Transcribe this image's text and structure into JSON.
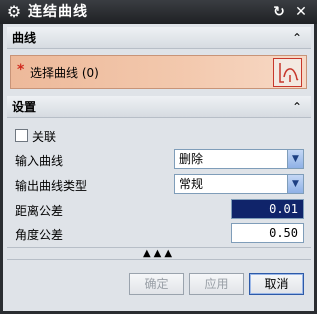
{
  "window": {
    "title": "连结曲线",
    "gear_icon": "gear-icon",
    "reset_icon": "reset-icon",
    "close_icon": "close-icon"
  },
  "sections": {
    "curve": {
      "header": "曲线",
      "select_label": "选择曲线 (0)",
      "required_marker": "*",
      "curve_button_icon": "select-curve-icon"
    },
    "settings": {
      "header": "设置",
      "associative_label": "关联",
      "associative_checked": false,
      "input_curve_label": "输入曲线",
      "input_curve_value": "删除",
      "output_type_label": "输出曲线类型",
      "output_type_value": "常规",
      "distance_tol_label": "距离公差",
      "distance_tol_value": "0.01",
      "angle_tol_label": "角度公差",
      "angle_tol_value": "0.50"
    }
  },
  "buttons": {
    "ok": "确定",
    "apply": "应用",
    "cancel": "取消"
  },
  "colors": {
    "title_bar": "#2a2d31",
    "selection_highlight": "#f1c3a6",
    "accent_blue": "#10246a"
  }
}
